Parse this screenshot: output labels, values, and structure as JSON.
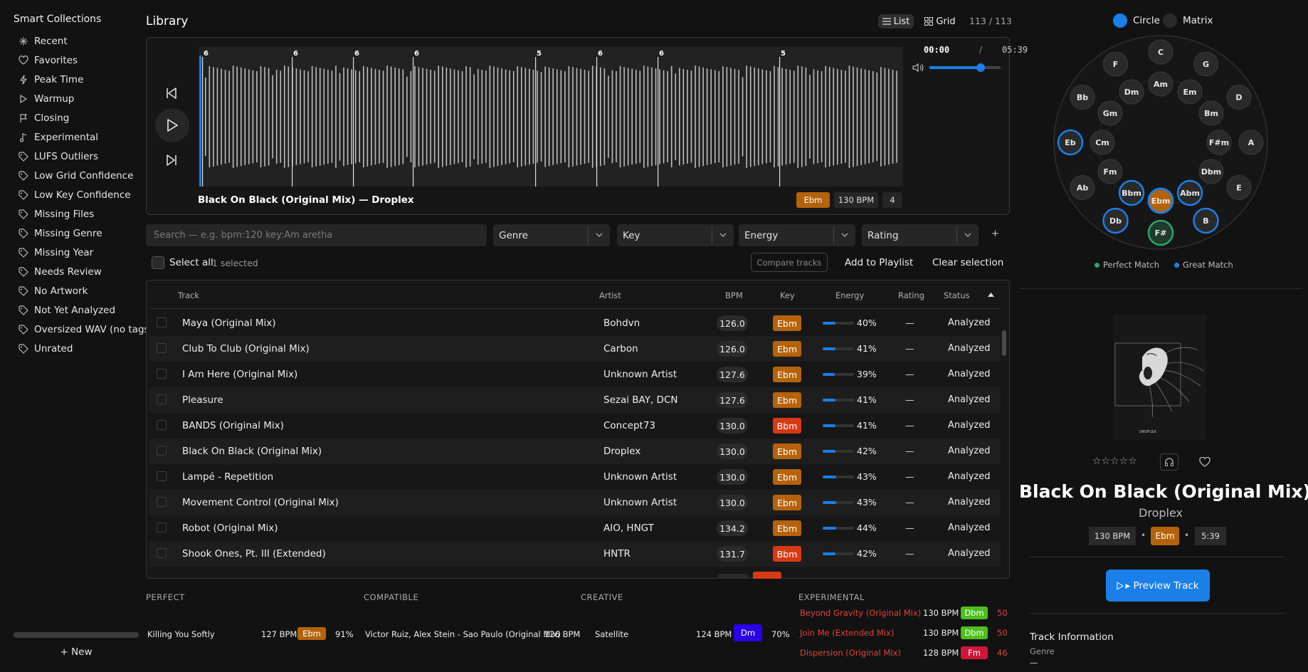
{
  "sidebar": {
    "title": "Smart Collections",
    "items": [
      {
        "label": "Recent",
        "icon": "sparkle-icon"
      },
      {
        "label": "Favorites",
        "icon": "heart-icon"
      },
      {
        "label": "Peak Time",
        "icon": "bolt-icon"
      },
      {
        "label": "Warmup",
        "icon": "play-outline-icon"
      },
      {
        "label": "Closing",
        "icon": "flag-icon"
      },
      {
        "label": "Experimental",
        "icon": "music-note-icon"
      },
      {
        "label": "LUFS Outliers",
        "icon": "tag-icon"
      },
      {
        "label": "Low Grid Confidence",
        "icon": "tag-icon"
      },
      {
        "label": "Low Key Confidence",
        "icon": "tag-icon"
      },
      {
        "label": "Missing Files",
        "icon": "tag-icon"
      },
      {
        "label": "Missing Genre",
        "icon": "tag-icon"
      },
      {
        "label": "Missing Year",
        "icon": "tag-icon"
      },
      {
        "label": "Needs Review",
        "icon": "tag-icon"
      },
      {
        "label": "No Artwork",
        "icon": "tag-icon"
      },
      {
        "label": "Not Yet Analyzed",
        "icon": "tag-icon"
      },
      {
        "label": "Oversized WAV (no tags)",
        "icon": "tag-icon"
      },
      {
        "label": "Unrated",
        "icon": "tag-icon"
      }
    ],
    "new_label": "+ New"
  },
  "library": {
    "title": "Library",
    "view_list": "List",
    "view_grid": "Grid",
    "count": "113 / 113"
  },
  "player": {
    "now_playing": "Black On Black (Original Mix) — Droplex",
    "key": "Ebm",
    "bpm": "130 BPM",
    "number": "4",
    "time_current": "00:00",
    "time_sep": "/",
    "time_total": "05:39",
    "volume": 0.72,
    "markers": [
      "6",
      "6",
      "6",
      "6",
      "5",
      "6",
      "6",
      "5"
    ]
  },
  "filters": {
    "search_placeholder": "Search — e.g. bpm:120 key:Am aretha",
    "genre": "Genre",
    "key": "Key",
    "energy": "Energy",
    "rating": "Rating",
    "more": "+"
  },
  "selection": {
    "select_all": "Select all",
    "count": "1 selected",
    "compare": "Compare tracks",
    "add_to_playlist": "Add to Playlist",
    "clear": "Clear selection"
  },
  "table": {
    "headers": {
      "track": "Track",
      "artist": "Artist",
      "bpm": "BPM",
      "key": "Key",
      "energy": "Energy",
      "rating": "Rating",
      "status": "Status"
    },
    "rows": [
      {
        "track": "Maya (Original Mix)",
        "artist": "Bohdvn",
        "bpm": "126.0",
        "key": "Ebm",
        "energy": "40%",
        "rating": "—",
        "status": "Analyzed"
      },
      {
        "track": "Club To Club (Original Mix)",
        "artist": "Carbon",
        "bpm": "126.0",
        "key": "Ebm",
        "energy": "41%",
        "rating": "—",
        "status": "Analyzed"
      },
      {
        "track": "I Am Here (Original Mix)",
        "artist": "Unknown Artist",
        "bpm": "127.6",
        "key": "Ebm",
        "energy": "39%",
        "rating": "—",
        "status": "Analyzed"
      },
      {
        "track": "Pleasure",
        "artist": "Sezai BAY, DCN",
        "bpm": "127.6",
        "key": "Ebm",
        "energy": "41%",
        "rating": "—",
        "status": "Analyzed"
      },
      {
        "track": "BANDS (Original Mix)",
        "artist": "Concept73",
        "bpm": "130.0",
        "key": "Bbm",
        "energy": "41%",
        "rating": "—",
        "status": "Analyzed"
      },
      {
        "track": "Black On Black (Original Mix)",
        "artist": "Droplex",
        "bpm": "130.0",
        "key": "Ebm",
        "energy": "42%",
        "rating": "—",
        "status": "Analyzed"
      },
      {
        "track": "Lampé - Repetition",
        "artist": "Unknown Artist",
        "bpm": "130.0",
        "key": "Ebm",
        "energy": "43%",
        "rating": "—",
        "status": "Analyzed"
      },
      {
        "track": "Movement Control (Original Mix)",
        "artist": "Unknown Artist",
        "bpm": "130.0",
        "key": "Ebm",
        "energy": "43%",
        "rating": "—",
        "status": "Analyzed"
      },
      {
        "track": "Robot (Original Mix)",
        "artist": "AIO, HNGT",
        "bpm": "134.2",
        "key": "Ebm",
        "energy": "44%",
        "rating": "—",
        "status": "Analyzed"
      },
      {
        "track": "Shook Ones, Pt. III (Extended)",
        "artist": "HNTR",
        "bpm": "131.7",
        "key": "Bbm",
        "energy": "42%",
        "rating": "—",
        "status": "Analyzed"
      }
    ]
  },
  "suggestions": {
    "perfect_label": "PERFECT",
    "compatible_label": "COMPATIBLE",
    "creative_label": "CREATIVE",
    "experimental_label": "EXPERIMENTAL",
    "perfect": {
      "title": "Killing You Softly",
      "bpm": "127 BPM",
      "key": "Ebm",
      "match": "91%"
    },
    "compatible": {
      "title": "Victor Ruiz, Alex Stein - Sao Paulo (Original Mix)",
      "bpm": "126 BPM"
    },
    "creative": {
      "title": "Satellite",
      "bpm": "124 BPM",
      "key": "Dm",
      "match": "70%"
    },
    "experimental": [
      {
        "title": "Beyond Gravity (Original Mix)",
        "bpm": "130 BPM",
        "key": "Dbm",
        "match": "50"
      },
      {
        "title": "Join Me (Extended Mix)",
        "bpm": "130 BPM",
        "key": "Dbm",
        "match": "50"
      },
      {
        "title": "Dispersion (Original Mix)",
        "bpm": "128 BPM",
        "key": "Fm",
        "match": "46"
      }
    ]
  },
  "wheel": {
    "mode_circle": "Circle",
    "mode_matrix": "Matrix",
    "outer": [
      "C",
      "G",
      "D",
      "A",
      "E",
      "B",
      "F#",
      "Db",
      "Ab",
      "Eb",
      "Bb",
      "F"
    ],
    "inner": [
      "Am",
      "Em",
      "Bm",
      "F#m",
      "Dbm",
      "Abm",
      "Ebm",
      "Bbm",
      "Fm",
      "Cm",
      "Gm",
      "Dm"
    ],
    "legend_perfect": "Perfect Match",
    "legend_great": "Great Match"
  },
  "details": {
    "title": "Black On Black (Original Mix)",
    "artist": "Droplex",
    "bpm": "130 BPM",
    "key": "Ebm",
    "length": "5:39",
    "dot": "•",
    "preview_label": "▸ Preview Track",
    "info_title": "Track Information",
    "genre_label": "Genre",
    "genre_value": "—",
    "rating_stars": "☆☆☆☆☆"
  },
  "colors": {
    "accent": "#1a7fe8",
    "key_orange": "#b5630b",
    "key_red": "#d63a14",
    "key_green": "#4dbf1d",
    "key_blue": "#2b00e8",
    "key_crimson": "#d0153a",
    "perfect_green": "#2ea56b"
  }
}
